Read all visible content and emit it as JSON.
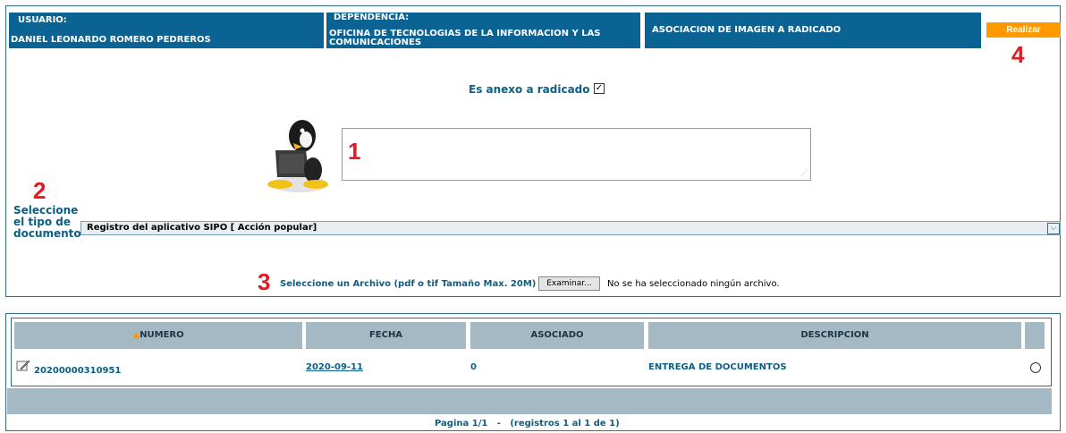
{
  "header": {
    "usuario_label": "USUARIO:",
    "usuario_value": "DANIEL LEONARDO ROMERO PEDREROS",
    "dependencia_label": "DEPENDENCIA:",
    "dependencia_value": "OFICINA DE TECNOLOGIAS DE LA INFORMACION Y LAS COMUNICACIONES",
    "accion": "ASOCIACION DE IMAGEN A RADICADO",
    "realizar_button": "Realizar"
  },
  "annotations": {
    "n1": "1",
    "n2": "2",
    "n3": "3",
    "n4": "4"
  },
  "form": {
    "anexo_label": "Es anexo a radicado",
    "anexo_checked": true,
    "tipo_label": "Seleccione el tipo de documento",
    "tipo_selected": "Registro del aplicativo SIPO [ Acción popular]",
    "archivo_label": "Seleccione un Archivo (pdf o tif Tamaño Max. 20M)",
    "examinar_button": "Examinar...",
    "no_file_text": "No se ha seleccionado ningún archivo."
  },
  "table": {
    "columns": [
      "NUMERO",
      "FECHA",
      "ASOCIADO",
      "DESCRIPCION"
    ],
    "rows": [
      {
        "numero": "20200000310951",
        "fecha": "2020-09-11",
        "asociado": "0",
        "descripcion": "ENTREGA DE DOCUMENTOS"
      }
    ],
    "pager": "Pagina 1/1   -   (registros 1 al 1 de 1)"
  },
  "icons": [
    "tux-penguin-laptop-icon",
    "sort-asc-icon",
    "edit-pencil-icon",
    "chevron-down-icon"
  ],
  "colors": {
    "header_blue": "#0b6394",
    "accent_orange": "#ff9900",
    "table_header": "#a5b9c5",
    "link_blue": "#0b5f84",
    "annotation_red": "#e01b24"
  }
}
